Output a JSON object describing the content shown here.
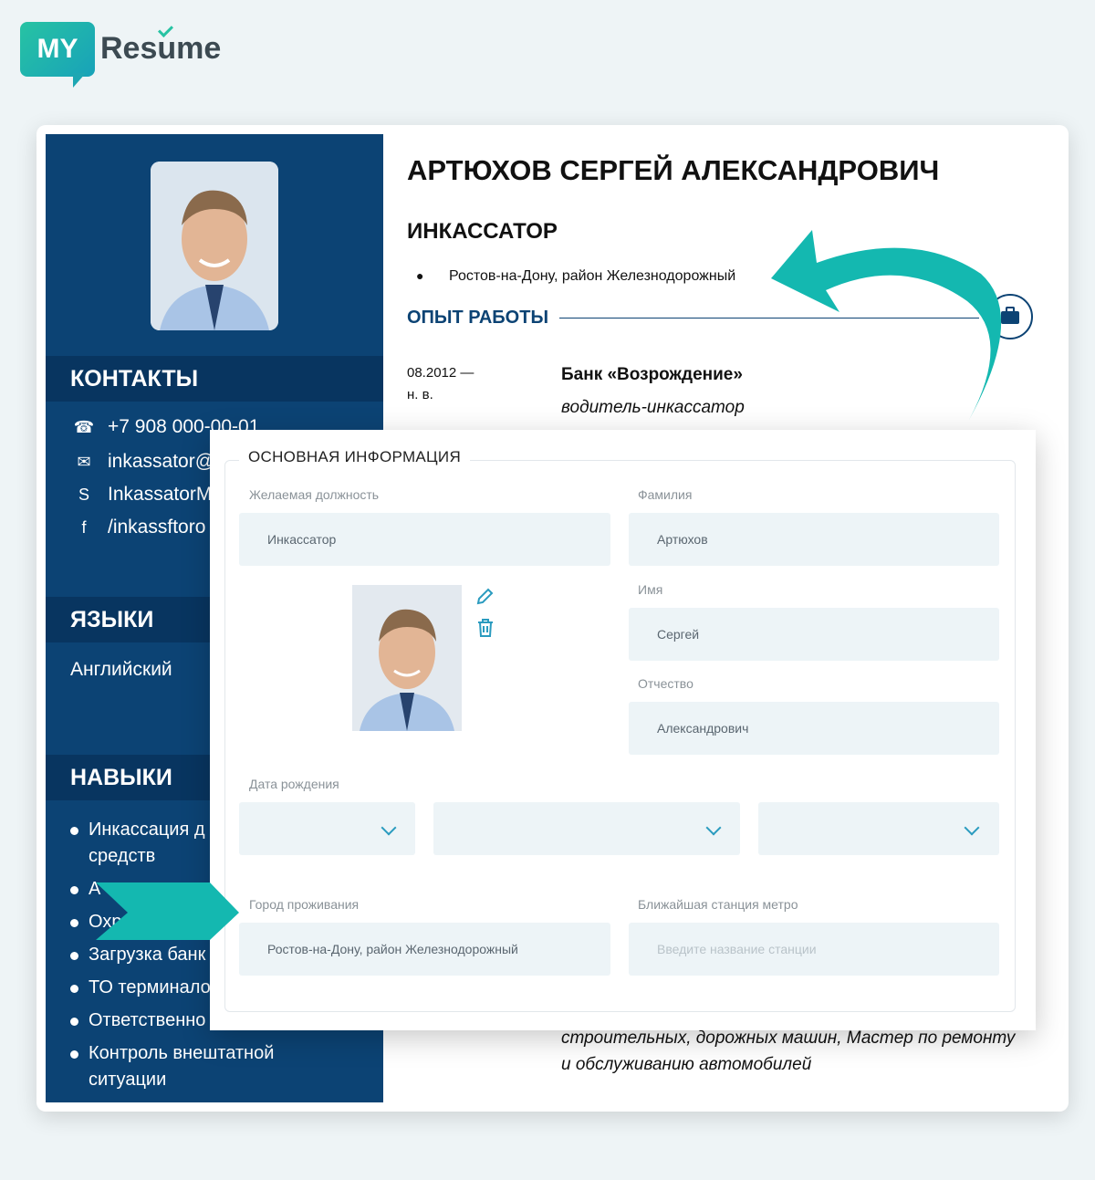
{
  "logo": {
    "badge": "MY",
    "word": "Resume"
  },
  "resume": {
    "name": "АРТЮХОВ СЕРГЕЙ АЛЕКСАНДРОВИЧ",
    "position": "ИНКАССАТОР",
    "location": "Ростов-на-Дону, район Железнодорожный",
    "contacts_title": "КОНТАКТЫ",
    "contacts": [
      {
        "icon": "phone-icon",
        "text": "+7 908 000-00-01"
      },
      {
        "icon": "email-icon",
        "text": "inkassator@"
      },
      {
        "icon": "skype-icon",
        "text": "InkassatorM"
      },
      {
        "icon": "facebook-icon",
        "text": "/inkassftoro"
      }
    ],
    "languages_title": "ЯЗЫКИ",
    "language": "Английский",
    "skills_title": "НАВЫКИ",
    "skills": [
      "Инкассация д средств",
      "А",
      "Охр",
      "Загрузка банк",
      "ТО терминало",
      "Ответственно",
      "Контроль внештатной ситуации"
    ],
    "experience_title": "ОПЫТ РАБОТЫ",
    "experience": {
      "date_line1": "08.2012 —",
      "date_line2": "н. в.",
      "company": "Банк «Возрождение»",
      "role": "водитель-инкассатор"
    },
    "bottom_line1": "строительных, дорожных машин, Мастер по ремонту",
    "bottom_line2": "и обслуживанию автомобилей"
  },
  "form": {
    "legend": "ОСНОВНАЯ ИНФОРМАЦИЯ",
    "desired_position_label": "Желаемая должность",
    "desired_position_value": "Инкассатор",
    "surname_label": "Фамилия",
    "surname_value": "Артюхов",
    "name_label": "Имя",
    "name_value": "Сергей",
    "patronymic_label": "Отчество",
    "patronymic_value": "Александрович",
    "birthdate_label": "Дата рождения",
    "city_label": "Город проживания",
    "city_value": "Ростов-на-Дону, район Железнодорожный",
    "metro_label": "Ближайшая станция метро",
    "metro_placeholder": "Введите название станции"
  },
  "colors": {
    "accent": "#0c4374",
    "teal": "#14b8b0",
    "field_bg": "#edf4f7"
  }
}
